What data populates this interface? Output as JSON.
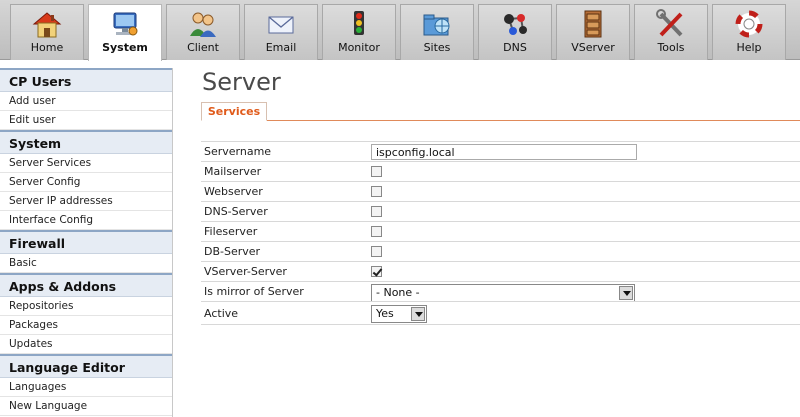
{
  "topnav": {
    "tabs": [
      {
        "label": "Home",
        "icon": "home-icon",
        "active": false
      },
      {
        "label": "System",
        "icon": "system-monitor-icon",
        "active": true
      },
      {
        "label": "Client",
        "icon": "client-users-icon",
        "active": false
      },
      {
        "label": "Email",
        "icon": "envelope-icon",
        "active": false
      },
      {
        "label": "Monitor",
        "icon": "traffic-light-icon",
        "active": false
      },
      {
        "label": "Sites",
        "icon": "globe-folder-icon",
        "active": false
      },
      {
        "label": "DNS",
        "icon": "network-nodes-icon",
        "active": false
      },
      {
        "label": "VServer",
        "icon": "cabinet-icon",
        "active": false
      },
      {
        "label": "Tools",
        "icon": "tools-icon",
        "active": false
      },
      {
        "label": "Help",
        "icon": "lifebuoy-icon",
        "active": false
      }
    ]
  },
  "sidebar": {
    "sections": [
      {
        "title": "CP Users",
        "items": [
          "Add user",
          "Edit user"
        ]
      },
      {
        "title": "System",
        "items": [
          "Server Services",
          "Server Config",
          "Server IP addresses",
          "Interface Config"
        ]
      },
      {
        "title": "Firewall",
        "items": [
          "Basic"
        ]
      },
      {
        "title": "Apps & Addons",
        "items": [
          "Repositories",
          "Packages",
          "Updates"
        ]
      },
      {
        "title": "Language Editor",
        "items": [
          "Languages",
          "New Language"
        ]
      }
    ]
  },
  "main": {
    "title": "Server",
    "subtab": "Services",
    "fields": {
      "servername": {
        "label": "Servername",
        "value": "ispconfig.local"
      },
      "mailserver": {
        "label": "Mailserver",
        "checked": false
      },
      "webserver": {
        "label": "Webserver",
        "checked": false
      },
      "dnsserver": {
        "label": "DNS-Server",
        "checked": false
      },
      "fileserver": {
        "label": "Fileserver",
        "checked": false
      },
      "dbserver": {
        "label": "DB-Server",
        "checked": false
      },
      "vserver": {
        "label": "VServer-Server",
        "checked": true
      },
      "mirror": {
        "label": "Is mirror of Server",
        "value": "- None -"
      },
      "active": {
        "label": "Active",
        "value": "Yes"
      }
    }
  },
  "colors": {
    "accent": "#e05a1a",
    "sidebar_head_bg": "#e6ecf4"
  }
}
